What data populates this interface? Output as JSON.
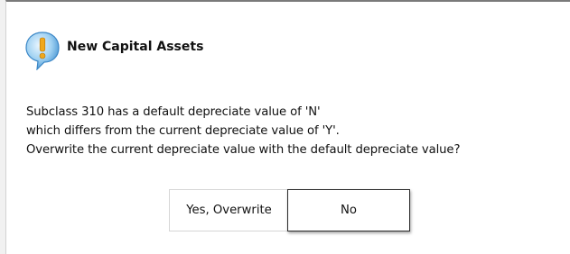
{
  "dialog": {
    "title": "New Capital Assets",
    "icon": "info-bubble-icon",
    "message_lines": [
      "Subclass 310 has a default depreciate value of 'N'",
      "which differs from the current depreciate value of 'Y'.",
      "Overwrite the current depreciate value with the default depreciate value?"
    ],
    "buttons": {
      "yes_label": "Yes, Overwrite",
      "no_label": "No"
    }
  },
  "colors": {
    "background": "#f1f1f1",
    "dialog": "#ffffff",
    "icon_blue": "#4aa3df",
    "icon_mark": "#f0a81c"
  }
}
